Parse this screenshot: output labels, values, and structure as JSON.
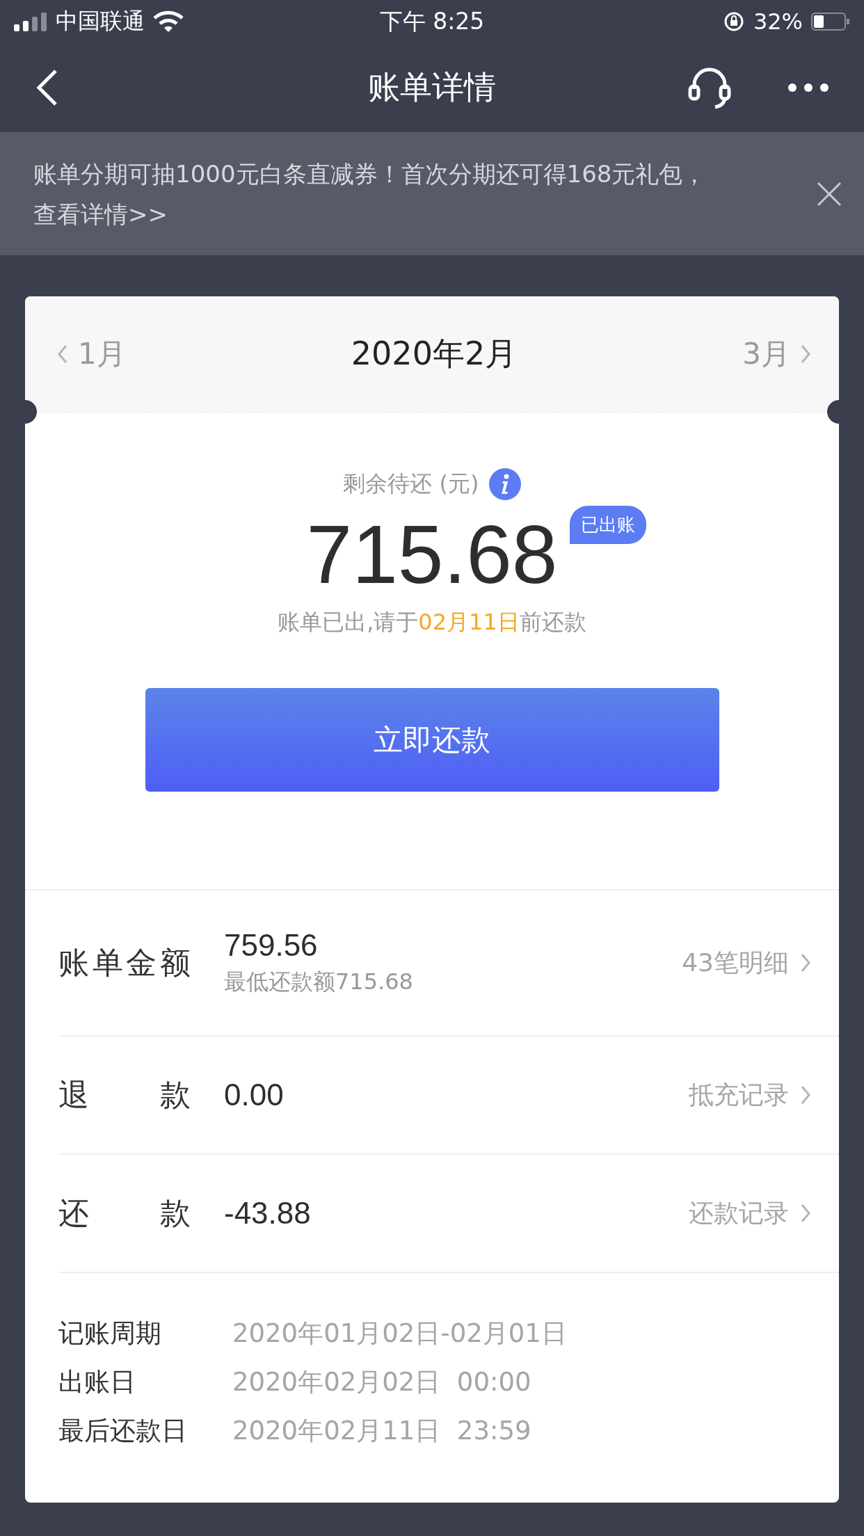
{
  "status_bar": {
    "carrier": "中国联通",
    "time": "下午 8:25",
    "battery": "32%"
  },
  "nav": {
    "title": "账单详情"
  },
  "banner": {
    "text": "账单分期可抽1000元白条直减券！首次分期还可得168元礼包，查看详情>>"
  },
  "month_nav": {
    "prev": "1月",
    "current": "2020年2月",
    "next": "3月"
  },
  "summary": {
    "label": "剩余待还 (元)",
    "amount": "715.68",
    "badge": "已出账",
    "due_before": "账单已出,请于",
    "due_date": "02月11日",
    "due_after": "前还款"
  },
  "pay_button": "立即还款",
  "rows": [
    {
      "label": "账单金额",
      "value": "759.56",
      "sub": "最低还款额715.68",
      "link": "43笔明细"
    },
    {
      "label": "退款",
      "value": "0.00",
      "link": "抵充记录"
    },
    {
      "label": "还款",
      "value": "-43.88",
      "link": "还款记录"
    }
  ],
  "details": [
    {
      "label": "记账周期",
      "value": "2020年01月02日-02月01日"
    },
    {
      "label": "出账日",
      "value": "2020年02月02日  00:00"
    },
    {
      "label": "最后还款日",
      "value": "2020年02月11日  23:59"
    }
  ]
}
